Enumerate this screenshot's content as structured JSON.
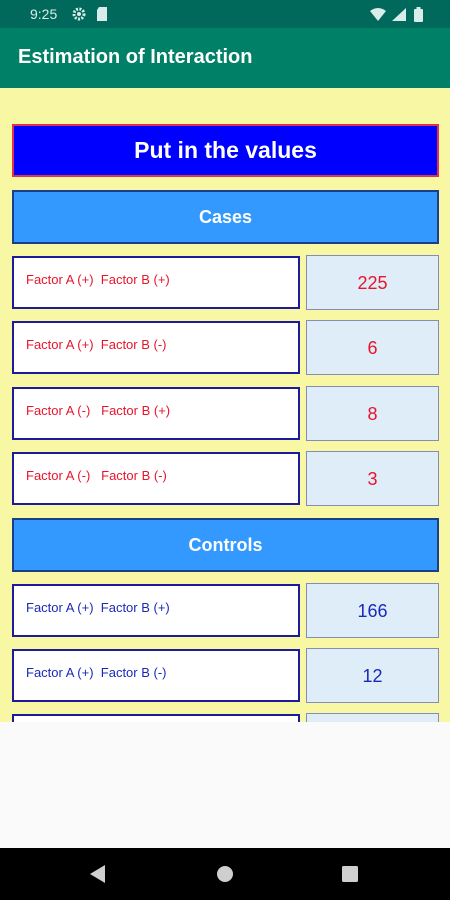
{
  "status_bar": {
    "time": "9:25",
    "icons": [
      "gear-icon",
      "sd-card-icon",
      "wifi-icon",
      "signal-icon",
      "battery-icon"
    ]
  },
  "app_bar": {
    "title": "Estimation of Interaction"
  },
  "main": {
    "heading": "Put in the values",
    "cases": {
      "header": "Cases",
      "rows": [
        {
          "label": "Factor A (+)  Factor B (+)",
          "value": "225"
        },
        {
          "label": "Factor A (+)  Factor B (-)",
          "value": "6"
        },
        {
          "label": "Factor A (-)   Factor B (+)",
          "value": "8"
        },
        {
          "label": "Factor A (-)   Factor B (-)",
          "value": "3"
        }
      ]
    },
    "controls": {
      "header": "Controls",
      "rows": [
        {
          "label": "Factor A (+)  Factor B (+)",
          "value": "166"
        },
        {
          "label": "Factor A (+)  Factor B (-)",
          "value": "12"
        }
      ]
    }
  },
  "colors": {
    "app_bar": "#008066",
    "content_bg": "#f8f8a4",
    "heading_bg": "#0000ff",
    "section_bg": "#3399ff",
    "case_text": "#e8142b",
    "control_text": "#1a2ab8"
  },
  "nav_bar": {
    "icons": [
      "back-icon",
      "home-icon",
      "recents-icon"
    ]
  }
}
